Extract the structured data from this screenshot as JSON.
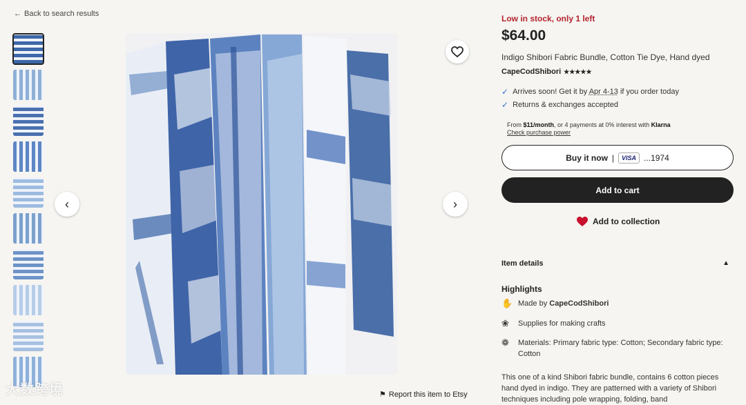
{
  "nav": {
    "back_label": "Back to search results"
  },
  "gallery": {
    "thumbnail_count": 10,
    "thumb_colors": [
      "#3d67a8",
      "#8fb0d6",
      "#4a70b0",
      "#5d86c4",
      "#9dbbe0",
      "#7ba0cc",
      "#6d93c7",
      "#b6cde8",
      "#a6c0e0",
      "#8eb1da"
    ]
  },
  "listing": {
    "stock_status": "Low in stock, only 1 left",
    "price": "$64.00",
    "title": "Indigo Shibori Fabric Bundle, Cotton Tie Dye, Hand dyed",
    "shop_name": "CapeCodShibori",
    "rating_stars": "★★★★★",
    "arrival_prefix": "Arrives soon! Get it by ",
    "arrival_dates": "Apr 4-13",
    "arrival_suffix": " if you order today",
    "returns": "Returns & exchanges accepted",
    "klarna_from": "From ",
    "klarna_amount": "$11/month",
    "klarna_mid": ", or 4 payments at 0% interest with ",
    "klarna_brand": "Klarna",
    "klarna_link": "Check purchase power",
    "buy_now_label": "Buy it now",
    "buy_sep": "|",
    "card_brand": "VISA",
    "card_last4": "...1974",
    "add_to_cart_label": "Add to cart",
    "add_to_collection_label": "Add to collection"
  },
  "details": {
    "section_title": "Item details",
    "highlights_title": "Highlights",
    "made_by_prefix": "Made by ",
    "made_by_shop": "CapeCodShibori",
    "supplies": "Supplies for making crafts",
    "materials": "Materials: Primary fabric type: Cotton; Secondary fabric type: Cotton",
    "description": "This one of a kind Shibori fabric bundle, contains 6 cotton pieces hand dyed in indigo. They are patterned with a variety of Shibori techniques including pole wrapping, folding, band"
  },
  "footer": {
    "report_label": "Report this item to Etsy"
  },
  "watermark": {
    "text": "大数跨境"
  },
  "colors": {
    "stock_red": "#b4232e",
    "button_dark": "#222222",
    "heart_red": "#c8102e",
    "check_blue": "#2e6fd1"
  }
}
